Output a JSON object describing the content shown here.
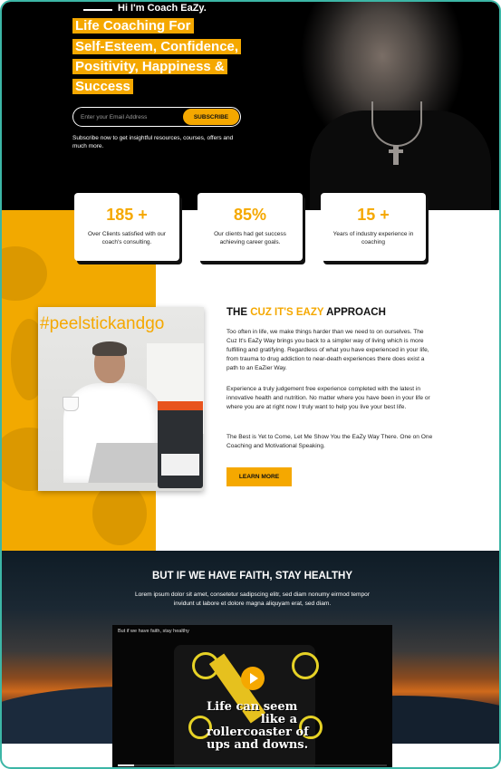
{
  "hero": {
    "greeting": "Hi I'm Coach EaZy.",
    "headline_lines": [
      "Life Coaching For",
      "Self-Esteem, Confidence,",
      "Positivity, Happiness &",
      "Success"
    ],
    "email_placeholder": "Enter your Email Address",
    "subscribe_label": "SUBSCRIBE",
    "subscribe_note": "Subscribe now to get insightful resources, courses, offers and much more."
  },
  "stats": [
    {
      "value": "185 +",
      "text": "Over Clients satisfied with our coach's consulting."
    },
    {
      "value": "85%",
      "text": "Our clients had get success achieving career goals."
    },
    {
      "value": "15 +",
      "text": "Years of industry experience in coaching"
    }
  ],
  "approach": {
    "photo_tag": "#peelstickandgo",
    "title_before": "THE ",
    "title_highlight": "CUZ IT'S EAZY",
    "title_after": " APPROACH",
    "paragraphs": [
      "Too often in life, we make things harder than we need to on ourselves. The Cuz It's EaZy Way brings you back to a simpler way of living which is more fulfilling and gratifying.  Regardless of what you have experienced in your life, from trauma to drug addiction to near-death experiences there does exist a path to an EaZier Way.",
      "Experience a truly judgement free experience completed with the latest in innovative health and nutrition. No matter where you have been in your life or where you are at right now I truly want to help you live your best life.",
      "The Best is Yet to Come, Let Me Show You the EaZy Way There.  One on One Coaching and Motivational Speaking."
    ],
    "button_label": "LEARN MORE"
  },
  "faith": {
    "title": "BUT IF WE HAVE FAITH, STAY HEALTHY",
    "text": "Lorem ipsum dolor sit amet, consetetur sadipscing elitr, sed diam nonumy eirmod tempor invidunt ut labore et dolore magna aliquyam erat, sed diam."
  },
  "video": {
    "caption": "But if we have faith, stay healthy",
    "overlay_lines": [
      "Life can seem",
      "like a",
      "rollercoaster of",
      "ups and downs."
    ],
    "progress": 0.06
  },
  "colors": {
    "accent": "#f5a800",
    "frame": "#3cb6a6",
    "hero_bg": "#000000"
  }
}
